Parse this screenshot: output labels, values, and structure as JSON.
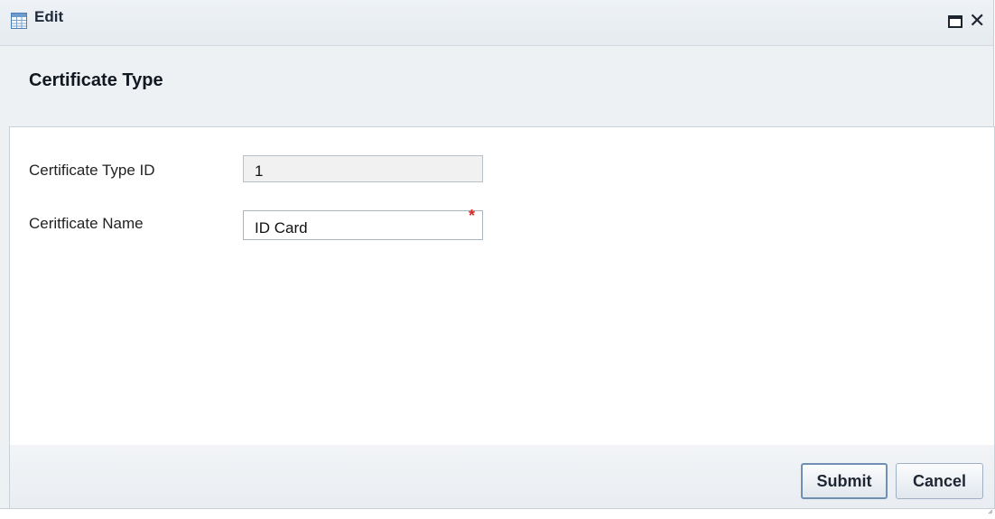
{
  "window": {
    "title": "Edit",
    "icon": "table-icon",
    "controls": {
      "maximize_icon": "maximize-icon",
      "close_glyph": "✕"
    }
  },
  "section": {
    "title": "Certificate Type"
  },
  "form": {
    "fields": [
      {
        "label": "Certificate Type ID",
        "value": "1",
        "readonly": true,
        "required": false
      },
      {
        "label": "Ceritficate Name",
        "value": "ID Card",
        "readonly": false,
        "required": true
      }
    ],
    "required_mark": "*"
  },
  "footer": {
    "submit_label": "Submit",
    "cancel_label": "Cancel"
  },
  "colors": {
    "required": "#e02424",
    "primary_border": "#6f8fb3"
  }
}
